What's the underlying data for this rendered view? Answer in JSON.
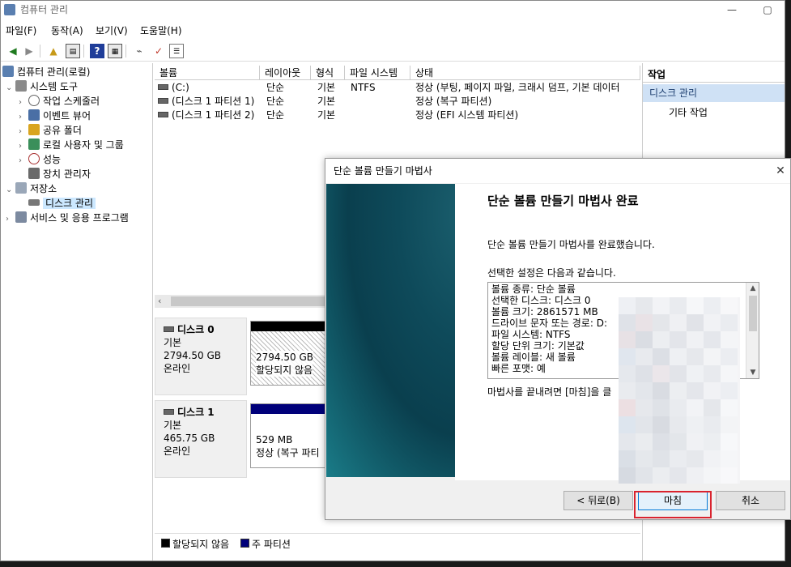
{
  "window": {
    "title": "컴퓨터 관리",
    "min": "—",
    "max": "▢"
  },
  "menu": [
    "파일(F)",
    "동작(A)",
    "보기(V)",
    "도움말(H)"
  ],
  "tree": {
    "root": "컴퓨터 관리(로컬)",
    "system_tools": "시스템 도구",
    "task_scheduler": "작업 스케줄러",
    "event_viewer": "이벤트 뷰어",
    "shared_folders": "공유 폴더",
    "local_users": "로컬 사용자 및 그룹",
    "performance": "성능",
    "device_manager": "장치 관리자",
    "storage": "저장소",
    "disk_management": "디스크 관리",
    "services": "서비스 및 응용 프로그램"
  },
  "volumes": {
    "headers": [
      "볼륨",
      "레이아웃",
      "형식",
      "파일 시스템",
      "상태"
    ],
    "rows": [
      [
        "(C:)",
        "단순",
        "기본",
        "NTFS",
        "정상 (부팅, 페이지 파일, 크래시 덤프, 기본 데이터"
      ],
      [
        "(디스크 1 파티션 1)",
        "단순",
        "기본",
        "",
        "정상 (복구 파티션)"
      ],
      [
        "(디스크 1 파티션 2)",
        "단순",
        "기본",
        "",
        "정상 (EFI 시스템 파티션)"
      ]
    ]
  },
  "disks": {
    "disk0": {
      "name": "디스크 0",
      "type": "기본",
      "size": "2794.50 GB",
      "status": "온라인",
      "part_size": "2794.50 GB",
      "part_state": "할당되지 않음"
    },
    "disk1": {
      "name": "디스크 1",
      "type": "기본",
      "size": "465.75 GB",
      "status": "온라인",
      "part_size": "529 MB",
      "part_state": "정상 (복구 파티"
    }
  },
  "legend": {
    "unallocated": "할당되지 않음",
    "primary": "주 파티션"
  },
  "actions": {
    "header": "작업",
    "selected": "디스크 관리",
    "more": "기타 작업"
  },
  "wizard": {
    "title": "단순 볼륨 만들기 마법사",
    "close": "✕",
    "heading": "단순 볼륨 만들기 마법사 완료",
    "p1": "단순 볼륨 만들기 마법사를 완료했습니다.",
    "p2": "선택한 설정은 다음과 같습니다.",
    "summary": [
      "볼륨 종류: 단순 볼륨",
      "선택한 디스크: 디스크 0",
      "볼륨 크기: 2861571 MB",
      "드라이브 문자 또는 경로: D:",
      "파일 시스템: NTFS",
      "할당 단위 크기: 기본값",
      "볼륨 레이블: 새 볼륨",
      "빠른 포맷: 예"
    ],
    "p3": "마법사를 끝내려면 [마침]을 클",
    "back": "< 뒤로(B)",
    "finish": "마침",
    "cancel": "취소"
  }
}
